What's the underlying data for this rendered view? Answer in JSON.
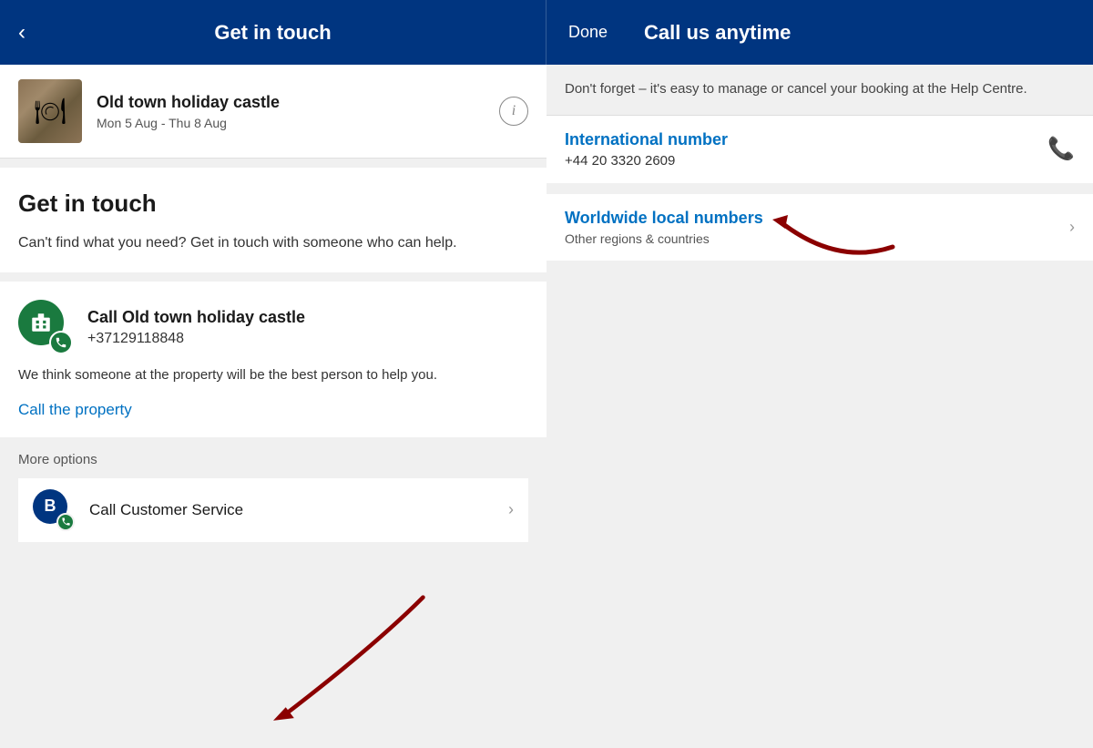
{
  "header": {
    "back_icon": "‹",
    "title": "Get in touch",
    "done_label": "Done",
    "call_title": "Call us anytime"
  },
  "left": {
    "property": {
      "name": "Old town holiday castle",
      "dates": "Mon 5 Aug - Thu 8 Aug"
    },
    "get_in_touch": {
      "heading": "Get in touch",
      "description": "Can't find what you need? Get in touch with someone who can help."
    },
    "call_property": {
      "name": "Call Old town holiday castle",
      "number": "+37129118848",
      "description": "We think someone at the property will be the best person to help you.",
      "link_label": "Call the property"
    },
    "more_options": {
      "label": "More options",
      "customer_service": {
        "label": "Call Customer Service"
      }
    }
  },
  "right": {
    "notice": "Don't forget – it's easy to manage or cancel your booking at the Help Centre.",
    "international": {
      "label": "International number",
      "number": "+44 20 3320 2609"
    },
    "worldwide": {
      "label": "Worldwide local numbers",
      "description": "Other regions & countries"
    }
  }
}
